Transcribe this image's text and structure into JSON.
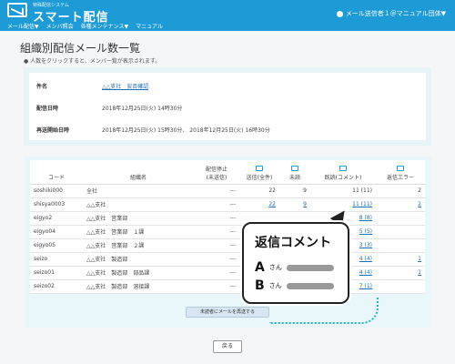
{
  "header": {
    "logo_small": "特殊配信システム",
    "logo_main": "スマート配信",
    "nav": [
      "メール配信▼",
      "メンバ照会",
      "各種メンテナンス▼",
      "マニュアル"
    ],
    "user": "メール送信者１＠マニュアル団体▼"
  },
  "page": {
    "title": "組織別配信メール数一覧",
    "note": "● 人数をクリックすると、メンバー覧が表示されます。"
  },
  "info": {
    "subject_label": "件名",
    "subject_value": "△△支社　安否確認",
    "date_label": "配信日時",
    "date_value": "2018年12月25日(火) 14時30分",
    "resend_label": "再送開始日時",
    "resend_value": "2018年12月25日(火) 15時30分、 2018年12月25日(火) 16時30分"
  },
  "table": {
    "headers": [
      "コード",
      "組織名",
      "配信停止\n(未送信)",
      "送信(全件)",
      "未読",
      "既読(コメント)",
      "返信エラー"
    ],
    "rows": [
      {
        "code": "soshiki000",
        "name": "全社",
        "stop": "---",
        "sent": "22",
        "unread": "9",
        "read": "11 (11)",
        "error": "2"
      },
      {
        "code": "shisya0003",
        "name": "△△支社",
        "stop": "---",
        "sent": "22",
        "unread": "9",
        "read": "11 (11)",
        "error": "2"
      },
      {
        "code": "eigyo2",
        "name": "△△支社　営業部",
        "stop": "---",
        "sent": "",
        "unread": "",
        "read": "8 (8)",
        "error": ""
      },
      {
        "code": "eigyo04",
        "name": "△△支社　営業部　１課",
        "stop": "---",
        "sent": "",
        "unread": "",
        "read": "5 (5)",
        "error": ""
      },
      {
        "code": "eigyo05",
        "name": "△△支社　営業部　２課",
        "stop": "---",
        "sent": "",
        "unread": "",
        "read": "3 (3)",
        "error": ""
      },
      {
        "code": "seizo",
        "name": "△△支社　製造部",
        "stop": "---",
        "sent": "",
        "unread": "",
        "read": "4 (4)",
        "error": "1"
      },
      {
        "code": "seizo01",
        "name": "△△支社　製造部　部品課",
        "stop": "---",
        "sent": "",
        "unread": "",
        "read": "4 (4)",
        "error": "1"
      },
      {
        "code": "seizo02",
        "name": "△△支社　製造部　溶接課",
        "stop": "---",
        "sent": "",
        "unread": "",
        "read": "7 (1)",
        "error": ""
      }
    ]
  },
  "buttons": {
    "resend": "未読者にメールを再送する",
    "back": "戻る"
  },
  "callout": {
    "title": "返信コメント",
    "row_a_letter": "A",
    "row_b_letter": "B",
    "san": "さん"
  }
}
